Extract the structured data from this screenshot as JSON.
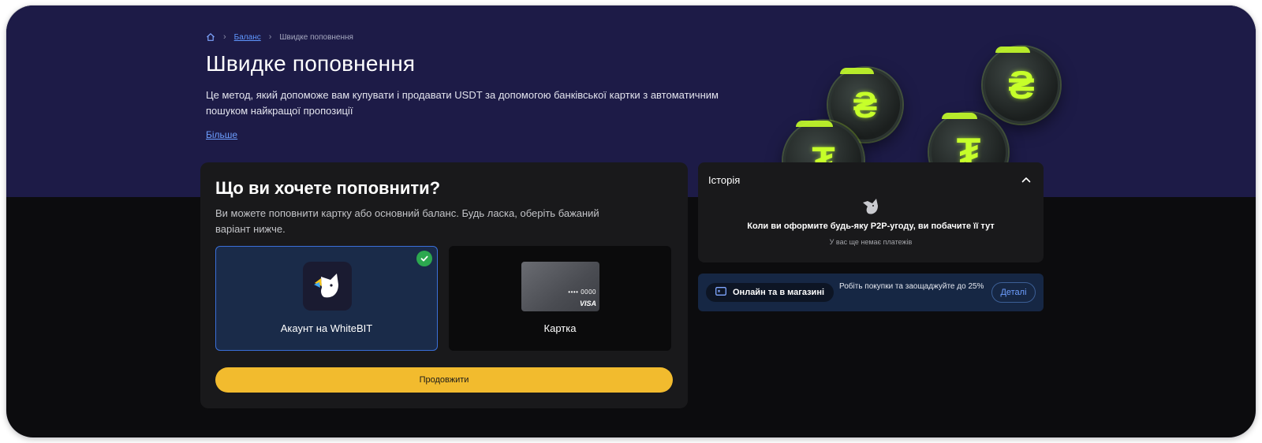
{
  "breadcrumb": {
    "home_icon": "home-icon",
    "items": [
      "Баланс",
      "Швидке поповнення"
    ]
  },
  "hero": {
    "title": "Швидке поповнення",
    "description": "Це метод, який допоможе вам купувати і продавати USDT за допомогою банківської картки з автоматичним пошуком найкращої пропозиції",
    "more_link": "Більше",
    "coins": [
      "hryvnia-coin",
      "tether-coin",
      "hryvnia-coin",
      "tether-coin"
    ]
  },
  "topup": {
    "title": "Що ви хочете поповнити?",
    "description": "Ви можете поповнити картку або основний баланс. Будь ласка, оберіть бажаний варіант нижче.",
    "options": [
      {
        "label": "Акаунт на WhiteBIT",
        "selected": true,
        "icon": "whitebit-logo-icon"
      },
      {
        "label": "Картка",
        "selected": false,
        "icon": "bank-card-icon",
        "card_number": "•••• 0000",
        "card_brand": "VISA"
      }
    ],
    "continue_label": "Продовжити"
  },
  "history": {
    "title": "Історія",
    "toggle_icon": "chevron-up-icon",
    "empty_title": "Коли ви оформите будь-яку P2P-угоду, ви побачите її тут",
    "empty_subtitle": "У вас ще немає платежів"
  },
  "promo": {
    "icon": "card-icon",
    "pill_label": "Онлайн та в магазині",
    "text": "Робіть покупки та заощаджуйте до 25%",
    "button_label": "Деталі"
  },
  "colors": {
    "hero_bg": "#1d1b47",
    "page_bg": "#0c0c0e",
    "card_bg": "#19191b",
    "accent_yellow": "#f2bb2e",
    "link_blue": "#5f97ff",
    "success_green": "#2ca84f",
    "coin_lime": "#c6ff2a"
  }
}
